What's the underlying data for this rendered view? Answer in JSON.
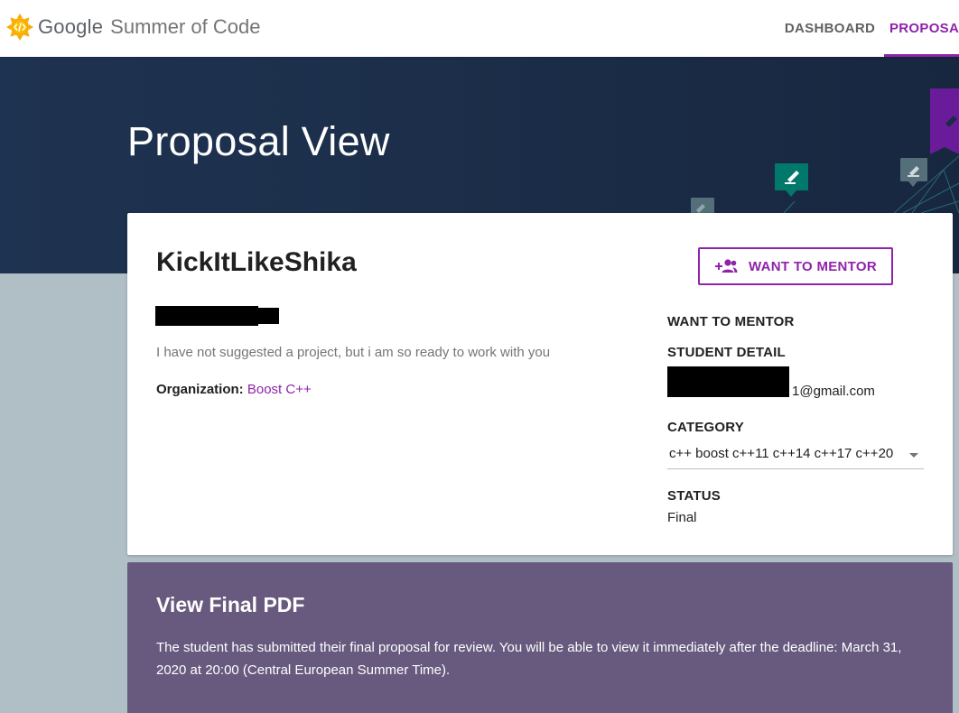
{
  "app": {
    "brand_google": "Google",
    "brand_program": "Summer of Code",
    "logo_icon": "gsoc-sun-code-icon",
    "accent_color": "#8e24aa"
  },
  "nav": {
    "tabs": [
      {
        "label": "DASHBOARD",
        "active": false
      },
      {
        "label": "PROPOSALS",
        "active": true
      }
    ]
  },
  "hero": {
    "title": "Proposal View"
  },
  "proposal": {
    "title": "KickItLikeShika",
    "description": "I have not suggested a project, but i am so ready to work with you",
    "organization_label": "Organization:",
    "organization_value": "Boost C++",
    "mentor_button_label": "WANT TO MENTOR",
    "mentor_button_icon": "add-people-icon"
  },
  "sidebar": {
    "want_to_mentor_heading": "WANT TO MENTOR",
    "student_detail_heading": "STUDENT DETAIL",
    "student_email_suffix": "1@gmail.com",
    "category_heading": "CATEGORY",
    "category_value": "c++ boost c++11 c++14 c++17 c++20",
    "status_heading": "STATUS",
    "status_value": "Final"
  },
  "pdf_section": {
    "title": "View Final PDF",
    "body": "The student has submitted their final proposal for review. You will be able to view it immediately after the deadline: March 31, 2020 at 20:00 (Central European Summer Time)."
  }
}
